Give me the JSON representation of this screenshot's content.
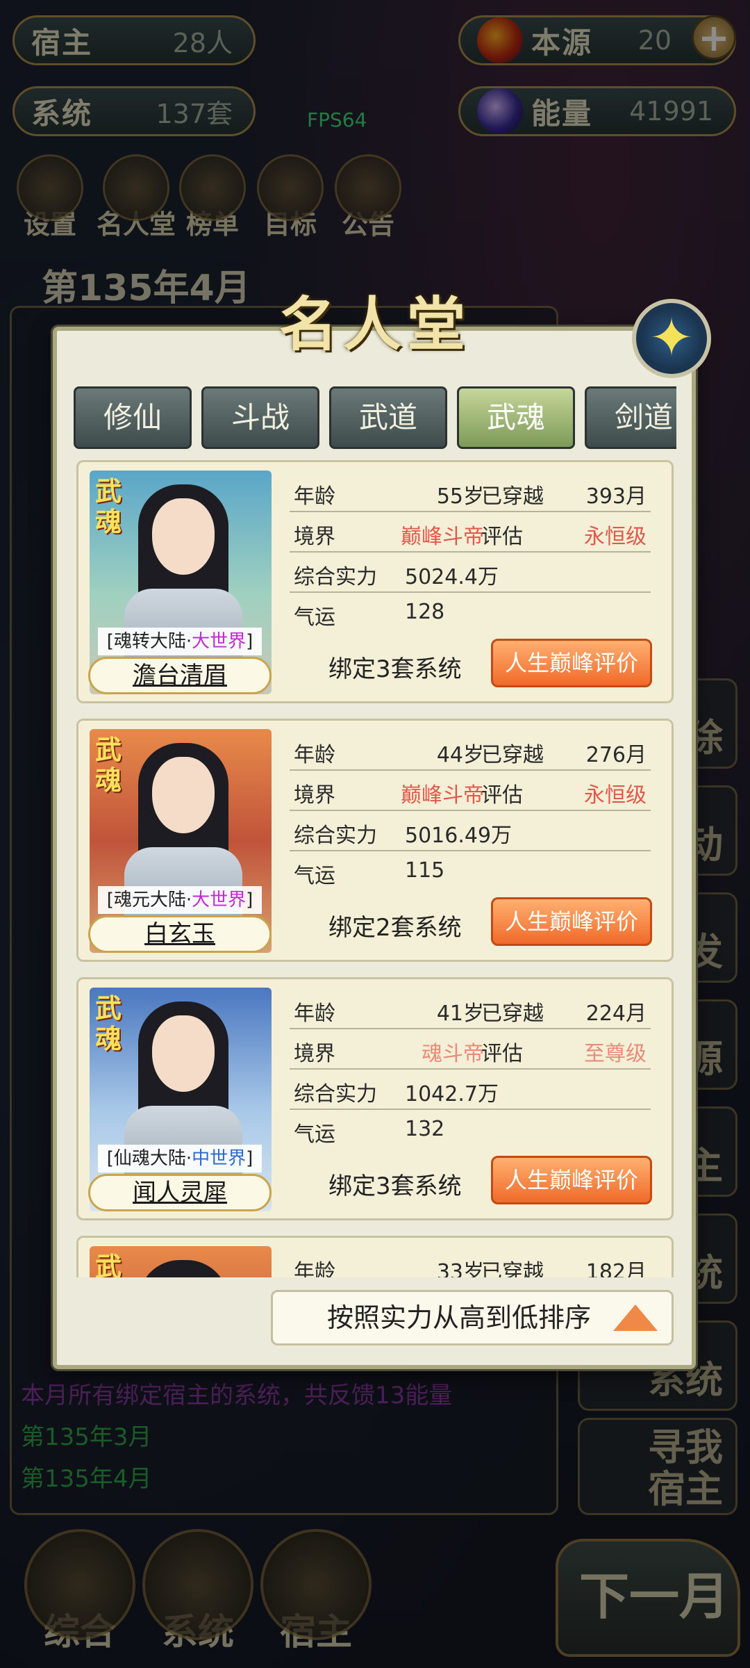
{
  "top_stats": {
    "host": {
      "label": "宿主",
      "value": "28人"
    },
    "system": {
      "label": "系统",
      "value": "137套"
    },
    "origin": {
      "label": "本源",
      "value": "20"
    },
    "energy": {
      "label": "能量",
      "value": "41991"
    }
  },
  "fps": "FPS64",
  "top_icons": [
    "设置",
    "名人堂",
    "榜单",
    "目标",
    "公告"
  ],
  "month_title": "第135年4月",
  "log_lines": [
    {
      "text": "本月所有绑定宿主的系统，共反馈13能量",
      "color": "#8a3aa0"
    },
    {
      "text": "第135年3月",
      "color": "#2fa84a"
    },
    {
      "text": "第135年4月",
      "color": "#2fa84a"
    }
  ],
  "right_buttons": [
    "除",
    "动",
    "发",
    "源",
    "主",
    "统",
    "系统"
  ],
  "find_host": "寻我\n宿主",
  "bottom_nav": [
    "综合",
    "系统",
    "宿主"
  ],
  "next_month": "下一月",
  "modal": {
    "title": "名人堂",
    "tabs": [
      "修仙",
      "斗战",
      "武道",
      "武魂",
      "剑道"
    ],
    "active_tab": "武魂",
    "labels": {
      "age": "年龄",
      "traveled": "已穿越",
      "realm": "境界",
      "assess": "评估",
      "power": "综合实力",
      "luck": "气运",
      "eval_button": "人生巅峰评价"
    },
    "entries": [
      {
        "badge": "武魂",
        "world_prefix": "[魂转大陆·",
        "world_hl": "大世界",
        "world_suffix": "]",
        "name": "澹台清眉",
        "age": "55岁",
        "traveled": "393月",
        "realm": "巅峰斗帝",
        "assess": "永恒级",
        "power": "5024.4万",
        "luck": "128",
        "bound": "绑定3套系统"
      },
      {
        "badge": "武魂",
        "world_prefix": "[魂元大陆·",
        "world_hl": "大世界",
        "world_suffix": "]",
        "name": "白玄玉",
        "age": "44岁",
        "traveled": "276月",
        "realm": "巅峰斗帝",
        "assess": "永恒级",
        "power": "5016.49万",
        "luck": "115",
        "bound": "绑定2套系统"
      },
      {
        "badge": "武魂",
        "world_prefix": "[仙魂大陆·",
        "world_hl": "中世界",
        "world_suffix": "]",
        "name": "闻人灵犀",
        "age": "41岁",
        "traveled": "224月",
        "realm": "魂斗帝",
        "assess": "至尊级",
        "power": "1042.7万",
        "luck": "132",
        "bound": "绑定3套系统"
      },
      {
        "badge": "武",
        "age": "33岁",
        "traveled": "182月"
      }
    ],
    "sort_label": "按照实力从高到低排序"
  },
  "colors": {
    "accent_red": "#e2584a",
    "button_orange": "#f06a2a",
    "tab_active": "#9ab86a"
  }
}
